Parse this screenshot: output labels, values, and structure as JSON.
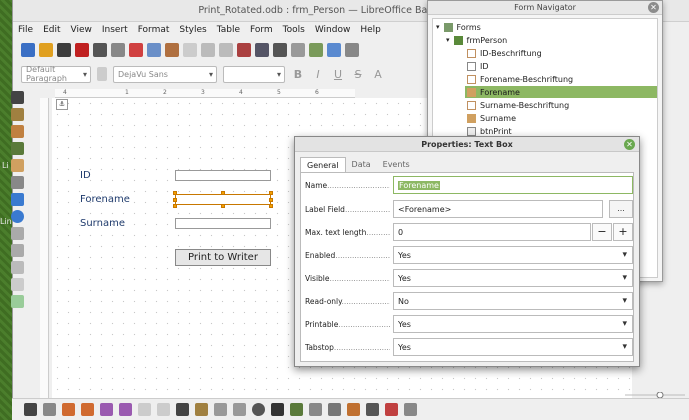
{
  "window": {
    "title": "Print_Rotated.odb : frm_Person — LibreOffice Base: Database Fo"
  },
  "menubar": [
    "File",
    "Edit",
    "View",
    "Insert",
    "Format",
    "Styles",
    "Table",
    "Form",
    "Tools",
    "Window",
    "Help"
  ],
  "toolbar2": {
    "paragraph_style": "Default Paragraph",
    "font_name": "DejaVu Sans",
    "font_size": "",
    "bold": "B",
    "italic": "I",
    "underline": "U",
    "strikethrough": "S",
    "highlight": "A"
  },
  "desktop_labels": [
    "Li",
    "Lin"
  ],
  "form": {
    "labels": {
      "id": "ID",
      "forename": "Forename",
      "surname": "Surname"
    },
    "print_button": "Print to Writer",
    "ruler_marks": [
      "4",
      "1",
      "2",
      "3",
      "4",
      "5",
      "6"
    ]
  },
  "navigator": {
    "title": "Form Navigator",
    "items": [
      {
        "label": "Forms",
        "icon": "forms-folder-icon",
        "level": 0,
        "selected": false
      },
      {
        "label": "frmPerson",
        "icon": "form-icon",
        "level": 1,
        "selected": false
      },
      {
        "label": "ID-Beschriftung",
        "icon": "label-icon",
        "level": 2,
        "selected": false
      },
      {
        "label": "ID",
        "icon": "textbox-icon",
        "level": 2,
        "selected": false
      },
      {
        "label": "Forename-Beschriftung",
        "icon": "label-icon",
        "level": 2,
        "selected": false
      },
      {
        "label": "Forename",
        "icon": "textbox-icon",
        "level": 2,
        "selected": true
      },
      {
        "label": "Surname-Beschriftung",
        "icon": "label-icon",
        "level": 2,
        "selected": false
      },
      {
        "label": "Surname",
        "icon": "textbox-icon",
        "level": 2,
        "selected": false
      },
      {
        "label": "btnPrint",
        "icon": "button-icon",
        "level": 2,
        "selected": false
      }
    ]
  },
  "properties": {
    "title": "Properties: Text Box",
    "tabs": [
      "General",
      "Data",
      "Events"
    ],
    "rows": {
      "name": {
        "label": "Name",
        "value": "Forename"
      },
      "label_field": {
        "label": "Label Field",
        "value": "<Forename>",
        "button": "..."
      },
      "max_length": {
        "label": "Max. text length",
        "value": "0",
        "minus": "−",
        "plus": "+"
      },
      "enabled": {
        "label": "Enabled",
        "value": "Yes"
      },
      "visible": {
        "label": "Visible",
        "value": "Yes"
      },
      "read_only": {
        "label": "Read-only",
        "value": "No"
      },
      "printable": {
        "label": "Printable",
        "value": "Yes"
      },
      "tabstop": {
        "label": "Tabstop",
        "value": "Yes"
      }
    }
  },
  "colors": {
    "accent": "#8db863",
    "label_text": "#1f3b6d",
    "selection_handle": "#f5a000"
  }
}
